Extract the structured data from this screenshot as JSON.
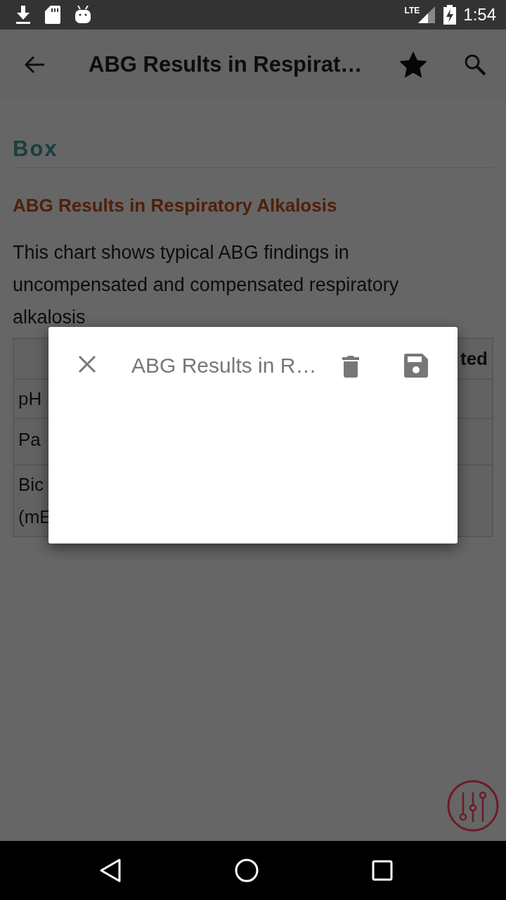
{
  "status_bar": {
    "network": "LTE",
    "time": "1:54"
  },
  "app_bar": {
    "title": "ABG Results in Respirat…"
  },
  "section": {
    "title": "Box"
  },
  "article": {
    "heading": "ABG Results in Respiratory Alkalosis",
    "paragraph": "This chart shows typical ABG findings in uncompensated and compensated respiratory alkalosis"
  },
  "table": {
    "column_3_header": "ted",
    "rows": [
      {
        "label_lines": [
          "pH"
        ]
      },
      {
        "label_lines": [
          "Pa"
        ]
      },
      {
        "label_lines": [
          "Bic",
          "(mE"
        ]
      }
    ]
  },
  "dialog": {
    "title": "ABG Results in R…"
  }
}
